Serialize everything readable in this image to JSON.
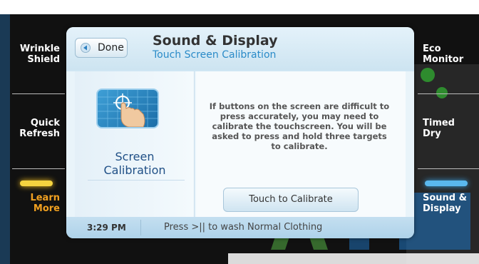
{
  "sidebar_left": {
    "items": [
      {
        "label_line1": "Wrinkle",
        "label_line2": "Shield"
      },
      {
        "label_line1": "Quick",
        "label_line2": "Refresh"
      },
      {
        "label_line1": "Learn",
        "label_line2": "More"
      }
    ]
  },
  "sidebar_right": {
    "items": [
      {
        "label_line1": "Eco",
        "label_line2": "Monitor"
      },
      {
        "label_line1": "Timed",
        "label_line2": "Dry"
      },
      {
        "label_line1": "Sound &",
        "label_line2": "Display"
      }
    ]
  },
  "dialog": {
    "done_label": "Done",
    "title": "Sound & Display",
    "subtitle": "Touch Screen Calibration",
    "calibration_line1": "Screen",
    "calibration_line2": "Calibration",
    "description": "If buttons on the screen are difficult to press accurately, you may need to calibrate the touchscreen. You will be asked to press and hold three targets to calibrate.",
    "calibrate_button": "Touch to Calibrate",
    "time": "3:29 PM",
    "status": "Press >|| to wash Normal Clothing"
  },
  "colors": {
    "accent_orange": "#f0a020",
    "accent_blue": "#2a8bc8",
    "glow_yellow": "#f4d340",
    "glow_blue": "#5ab8ee"
  }
}
